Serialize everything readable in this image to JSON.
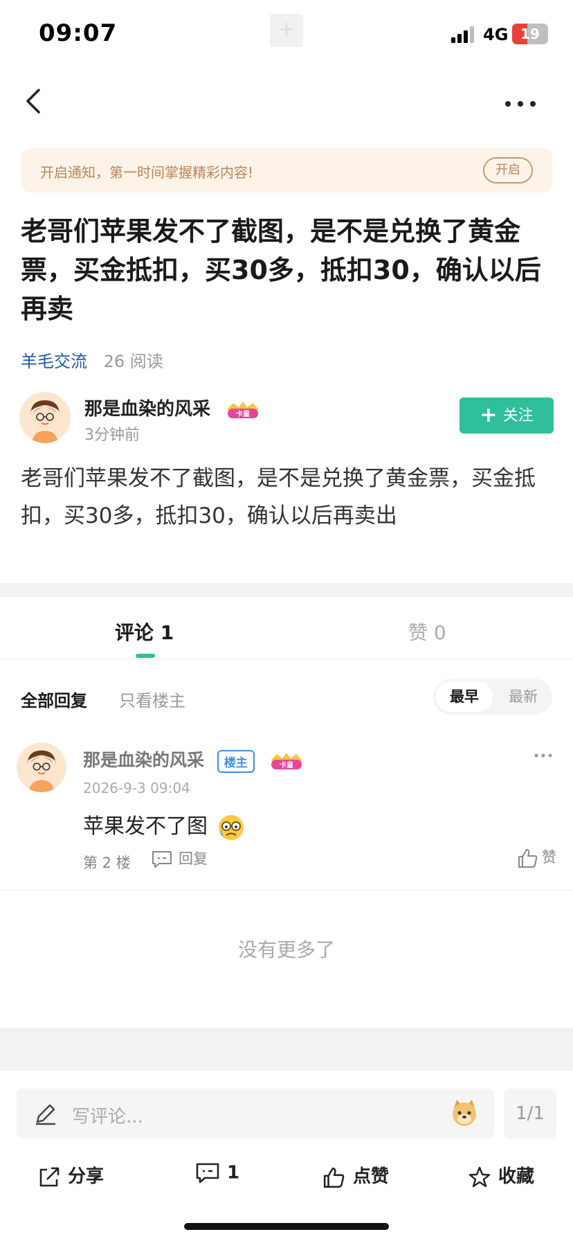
{
  "status_bar": {
    "time": "09:07",
    "network": "4G",
    "battery": "19",
    "colors": {
      "battery_low": "#e8413a"
    }
  },
  "nav": {
    "back_icon": "chevron-left-icon",
    "more_icon": "more-horizontal-icon"
  },
  "notify": {
    "text": "开启通知，第一时间掌握精彩内容!",
    "button": "开启"
  },
  "post": {
    "title": "老哥们苹果发不了截图，是不是兑换了黄金票，买金抵扣，买30多，抵扣30，确认以后再卖",
    "category": "羊毛交流",
    "reads": "26 阅读",
    "author": {
      "name": "那是血染的风采",
      "badge": "卡皇",
      "time": "3分钟前",
      "follow_label": "关注"
    },
    "body": "老哥们苹果发不了截图，是不是兑换了黄金票，买金抵扣，买30多，抵扣30，确认以后再卖出"
  },
  "tabs": {
    "comments": "评论 1",
    "likes": "赞 0",
    "accent": "#2fbf9b"
  },
  "filters": {
    "all": "全部回复",
    "op_only": "只看楼主",
    "sort_earliest": "最早",
    "sort_latest": "最新"
  },
  "comments": [
    {
      "name": "那是血染的风采",
      "op_badge": "楼主",
      "badge": "卡皇",
      "date": "2026-9-3 09:04",
      "text": "苹果发不了图",
      "floor": "第 2 楼",
      "reply_label": "回复",
      "like_label": "赞"
    }
  ],
  "no_more": "没有更多了",
  "bottom": {
    "input_placeholder": "写评论...",
    "page": "1/1",
    "share": "分享",
    "comment_count": "1",
    "like": "点赞",
    "favorite": "收藏"
  }
}
